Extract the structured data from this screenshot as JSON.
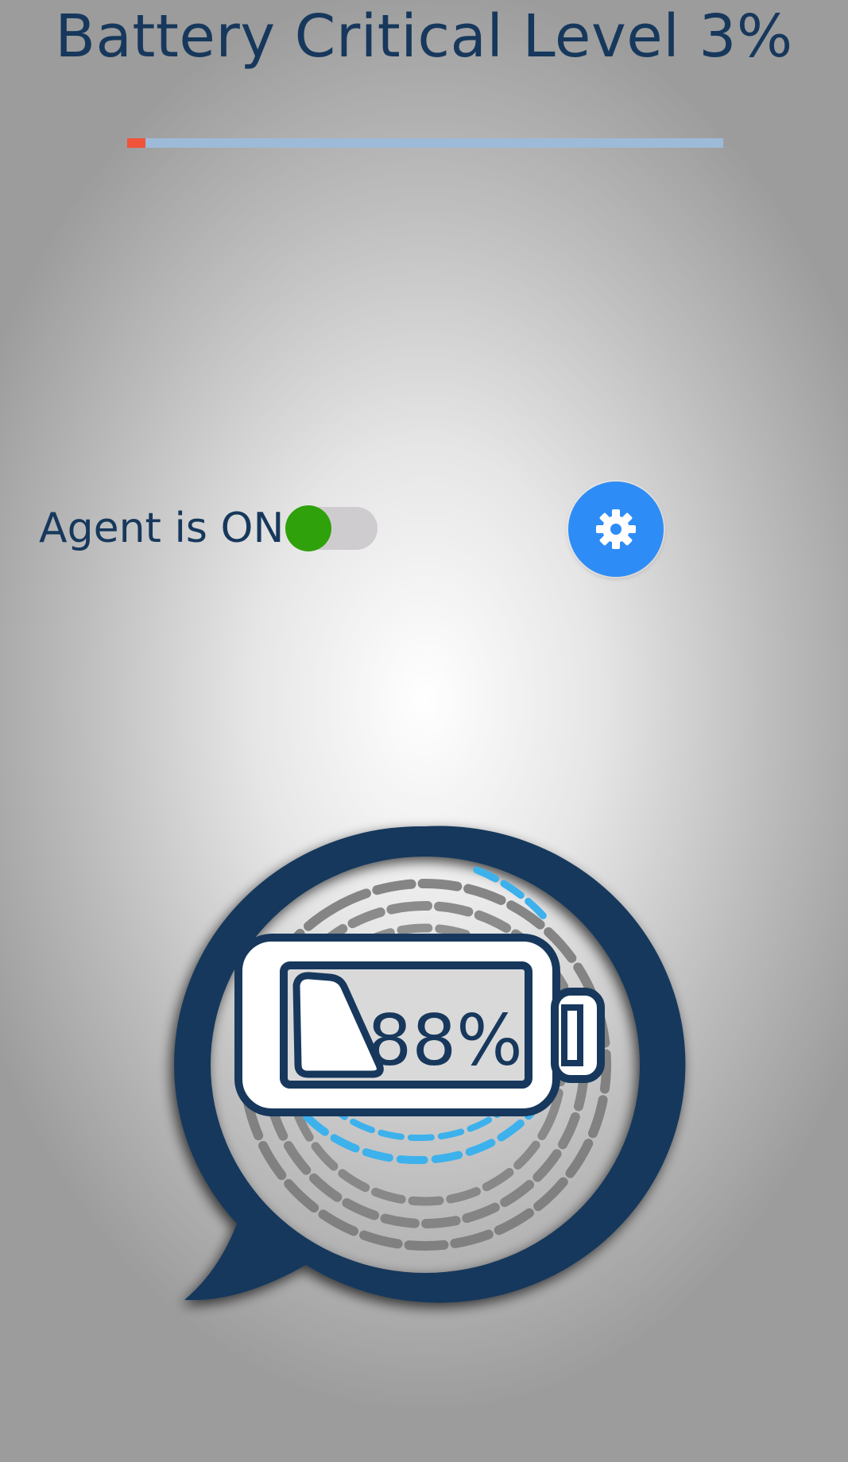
{
  "header": {
    "title": "Battery Critical Level 3%",
    "critical_level_percent": 3
  },
  "agent": {
    "label": "Agent is ON",
    "enabled": true
  },
  "settings": {
    "icon": "gear-icon"
  },
  "logo": {
    "percent_label": "88%",
    "icon": "battery-chat-logo"
  },
  "colors": {
    "title": "#17385c",
    "critical_fill": "#f0533a",
    "track": "#9dbad8",
    "toggle_on": "#2fa10b",
    "fab": "#2e8cf7",
    "logo_ring": "#17385c",
    "logo_arcs_gray": "#7a7a7a",
    "logo_arcs_blue": "#3db1ec"
  }
}
